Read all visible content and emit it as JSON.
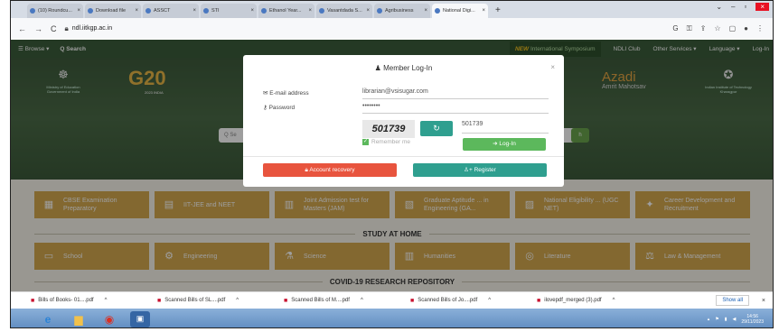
{
  "browser": {
    "tabs": [
      {
        "title": "(10) Roundcu...",
        "active": false
      },
      {
        "title": "Download file",
        "active": false
      },
      {
        "title": "ASSCT",
        "active": false
      },
      {
        "title": "STI",
        "active": false
      },
      {
        "title": "Ethanol Year...",
        "active": false
      },
      {
        "title": "Vasantdada S...",
        "active": false
      },
      {
        "title": "Agribusiness",
        "active": false
      },
      {
        "title": "National Digi...",
        "active": true
      }
    ],
    "url": "ndl.iitkgp.ac.in"
  },
  "site_nav": {
    "browse": "☰ Browse ▾",
    "search": "Q Search",
    "symposium_new": "NEW",
    "symposium": "International Symposium",
    "club": "NDLI Club",
    "other_services": "Other Services ▾",
    "language": "Language ▾",
    "login": "Log-In"
  },
  "hero": {
    "g20": "G20",
    "g20_sub": "2023 INDIA",
    "ministry": "Ministry of Education Government of India",
    "azadi_line1": "Azadi",
    "azadi_line2": "Amrit Mahotsav",
    "iit": "Indian Institute of Technology Kharagpur",
    "search_placeholder": "Q Se",
    "search_go": "h"
  },
  "categories_row1": [
    {
      "label": "CBSE Examination Preparatory",
      "icon": "exam-icon"
    },
    {
      "label": "IIT-JEE and NEET",
      "icon": "iit-icon"
    },
    {
      "label": "Joint Admission test for Masters (JAM)",
      "icon": "jam-icon"
    },
    {
      "label": "Graduate Aptitude ... in Engineering (GA...",
      "icon": "gate-icon"
    },
    {
      "label": "National Eligibility ... (UGC NET)",
      "icon": "ugc-icon"
    },
    {
      "label": "Career Development and Recruitment",
      "icon": "career-icon"
    }
  ],
  "section_study": "STUDY AT HOME",
  "categories_row2": [
    {
      "label": "School",
      "icon": "school-icon"
    },
    {
      "label": "Engineering",
      "icon": "engineering-icon"
    },
    {
      "label": "Science",
      "icon": "science-icon"
    },
    {
      "label": "Humanities",
      "icon": "humanities-icon"
    },
    {
      "label": "Literature",
      "icon": "literature-icon"
    },
    {
      "label": "Law & Management",
      "icon": "law-icon"
    }
  ],
  "section_covid": "COVID-19 RESEARCH REPOSITORY",
  "modal": {
    "title": "Member Log-In",
    "email_label": "E-mail address",
    "email_value": "librarian@vsisugar.com",
    "password_label": "Password",
    "password_value": "••••••••",
    "captcha_text": "501739",
    "captcha_input": "501739",
    "remember": "Remember me",
    "login_button": "Log-In",
    "recovery_button": "Account recovery",
    "register_button": "Register"
  },
  "downloads": [
    "Bills of Books- 01....pdf",
    "Scanned Bills of SL....pdf",
    "Scanned Bills of M....pdf",
    "Scanned Bills of Jo....pdf",
    "ilovepdf_merged (3).pdf"
  ],
  "downloads_show_all": "Show all",
  "taskbar": {
    "time": "14:56",
    "date": "29/11/2023"
  }
}
